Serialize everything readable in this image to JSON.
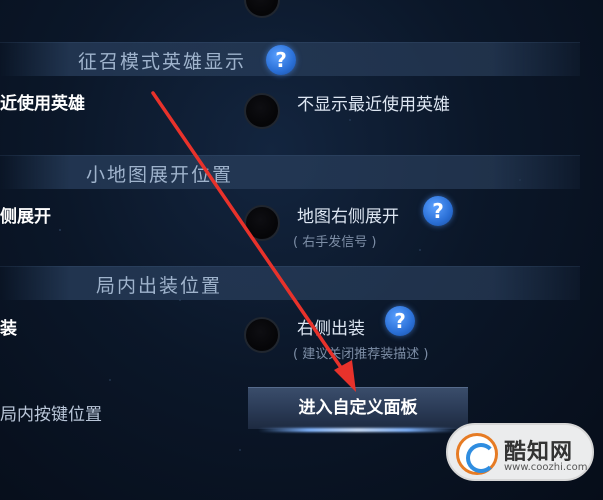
{
  "sections": [
    {
      "title": "征召模式英雄显示"
    },
    {
      "title": "小地图展开位置"
    },
    {
      "title": "局内出装位置"
    }
  ],
  "options": {
    "hero_left": "近使用英雄",
    "hero_right": "不显示最近使用英雄",
    "map_left": "侧展开",
    "map_right": "地图右侧展开",
    "map_right_sub": "( 右手发信号 )",
    "equip_left": "装",
    "equip_right": "右侧出装",
    "equip_right_sub": "( 建议关闭推荐装描述 )",
    "key_left": "局内按键位置"
  },
  "help_icon_glyph": "?",
  "custom_button_label": "进入自定义面板",
  "watermark": {
    "title": "酷知网",
    "url": "www.coozhi.com"
  },
  "colors": {
    "arrow": "#e8322b",
    "help_icon": "#2a6fd6",
    "background": "#0b1729"
  }
}
